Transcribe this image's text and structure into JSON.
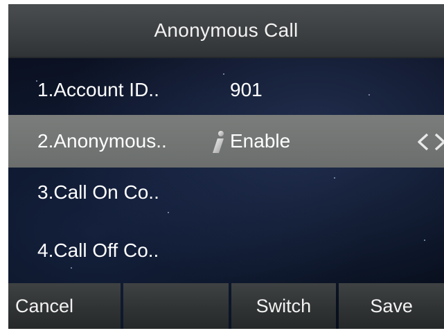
{
  "header": {
    "title": "Anonymous Call"
  },
  "menu": {
    "items": [
      {
        "label": "1.Account ID..",
        "value": "901"
      },
      {
        "label": "2.Anonymous..",
        "value": "Enable"
      },
      {
        "label": "3.Call On Co..",
        "value": ""
      },
      {
        "label": "4.Call Off Co..",
        "value": ""
      }
    ],
    "selected_index": 1
  },
  "softkeys": [
    {
      "label": "Cancel"
    },
    {
      "label": ""
    },
    {
      "label": "Switch"
    },
    {
      "label": "Save"
    }
  ],
  "icons": {
    "info": "info-icon",
    "switch_arrows": "left-right-arrows-icon"
  },
  "colors": {
    "title_bar": "#3b3e40",
    "selected_row": "#737674",
    "softkey": "#303334",
    "text": "#ffffff"
  }
}
